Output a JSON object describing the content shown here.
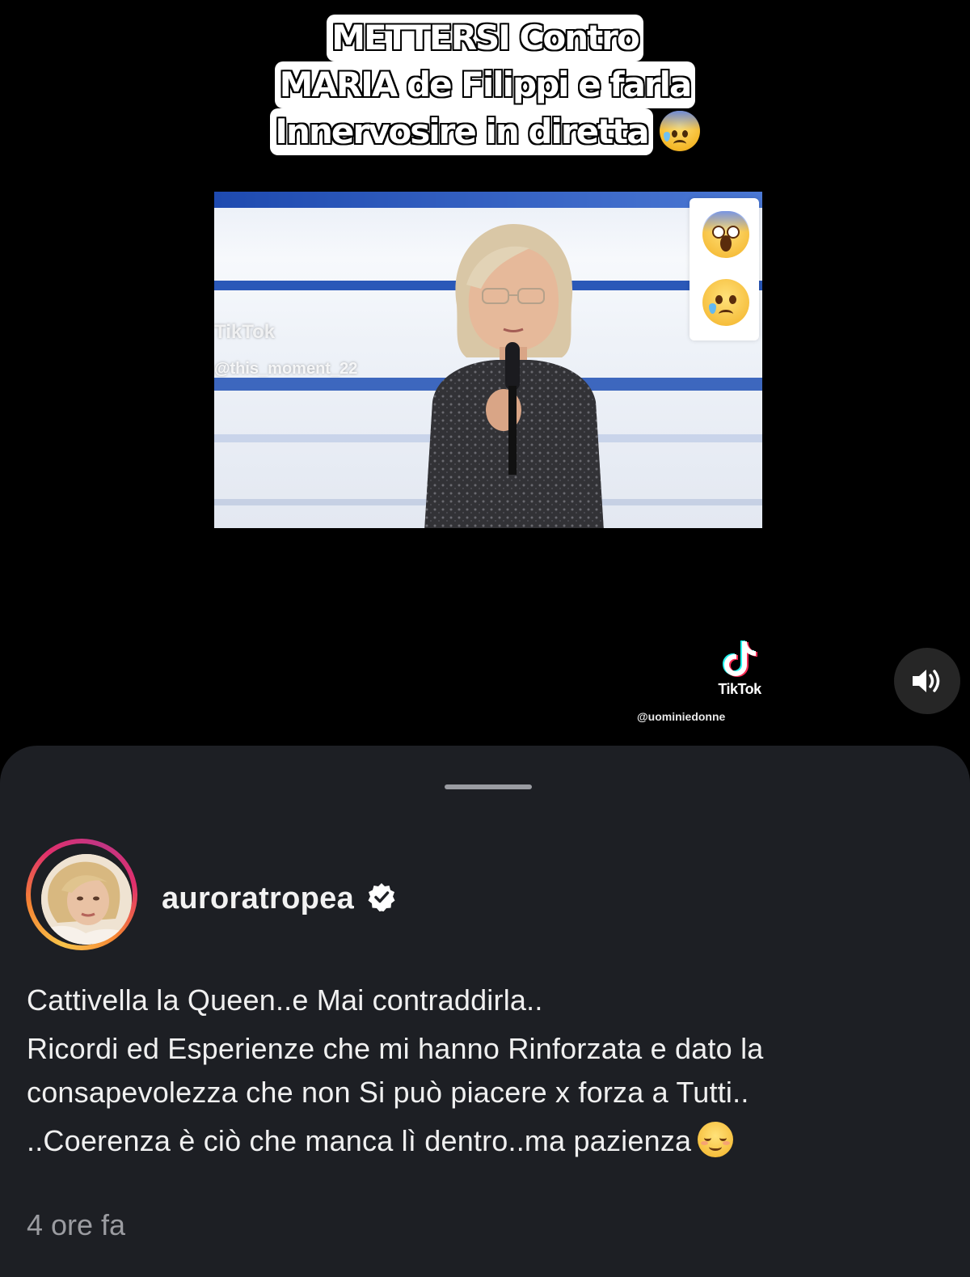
{
  "video": {
    "caption_lines": [
      "METTERSI Contro",
      "MARIA de Filippi e farla",
      "Innervosire in diretta"
    ],
    "caption_emoji": "anxious-face-with-sweat",
    "clip_watermark": {
      "brand": "TikTok",
      "handle": "@this_moment_22"
    },
    "reactions": [
      "face-screaming-in-fear",
      "crying-face"
    ],
    "watermark": {
      "brand": "TikTok",
      "handle": "@uominiedonne"
    },
    "volume_icon": "speaker-on-icon"
  },
  "sheet": {
    "username": "auroratropea",
    "verified": true,
    "post_lines": [
      "Cattivella la Queen..e Mai contraddirla..",
      "Ricordi ed Esperienze che mi hanno Rinforzata e dato la consapevolezza che non Si può piacere x forza a Tutti..",
      "..Coerenza è ciò che manca lì dentro..ma pazienza"
    ],
    "post_emoji": "smiling-face",
    "timestamp": "4 ore fa"
  },
  "colors": {
    "background": "#000000",
    "sheet": "#1d1f24",
    "text": "#f0f0f0",
    "muted": "#9b9ca1",
    "story_ring": [
      "#f9c44a",
      "#f58433",
      "#e1306c",
      "#c13584"
    ]
  }
}
